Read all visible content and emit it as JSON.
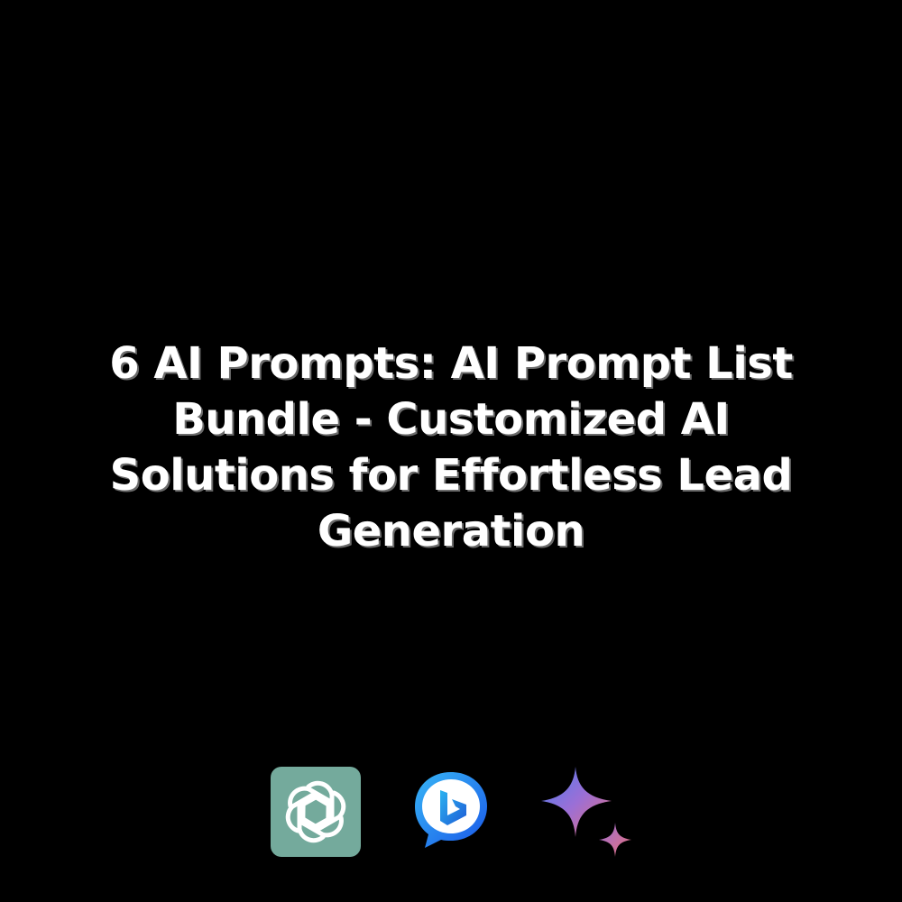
{
  "title": "6 AI Prompts: AI Prompt List Bundle - Customized AI Solutions for Effortless Lead Generation",
  "colors": {
    "background": "#000000",
    "text": "#ffffff",
    "chatgpt_tile": "#74aa9c",
    "bing_blue": "#1f6ff2",
    "gemini_gradient": [
      "#4a7df0",
      "#9b6fd6",
      "#e8707a"
    ]
  },
  "logos": [
    {
      "icon": "chatgpt-logo-icon"
    },
    {
      "icon": "bing-chat-logo-icon"
    },
    {
      "icon": "gemini-sparkle-logo-icon"
    }
  ]
}
